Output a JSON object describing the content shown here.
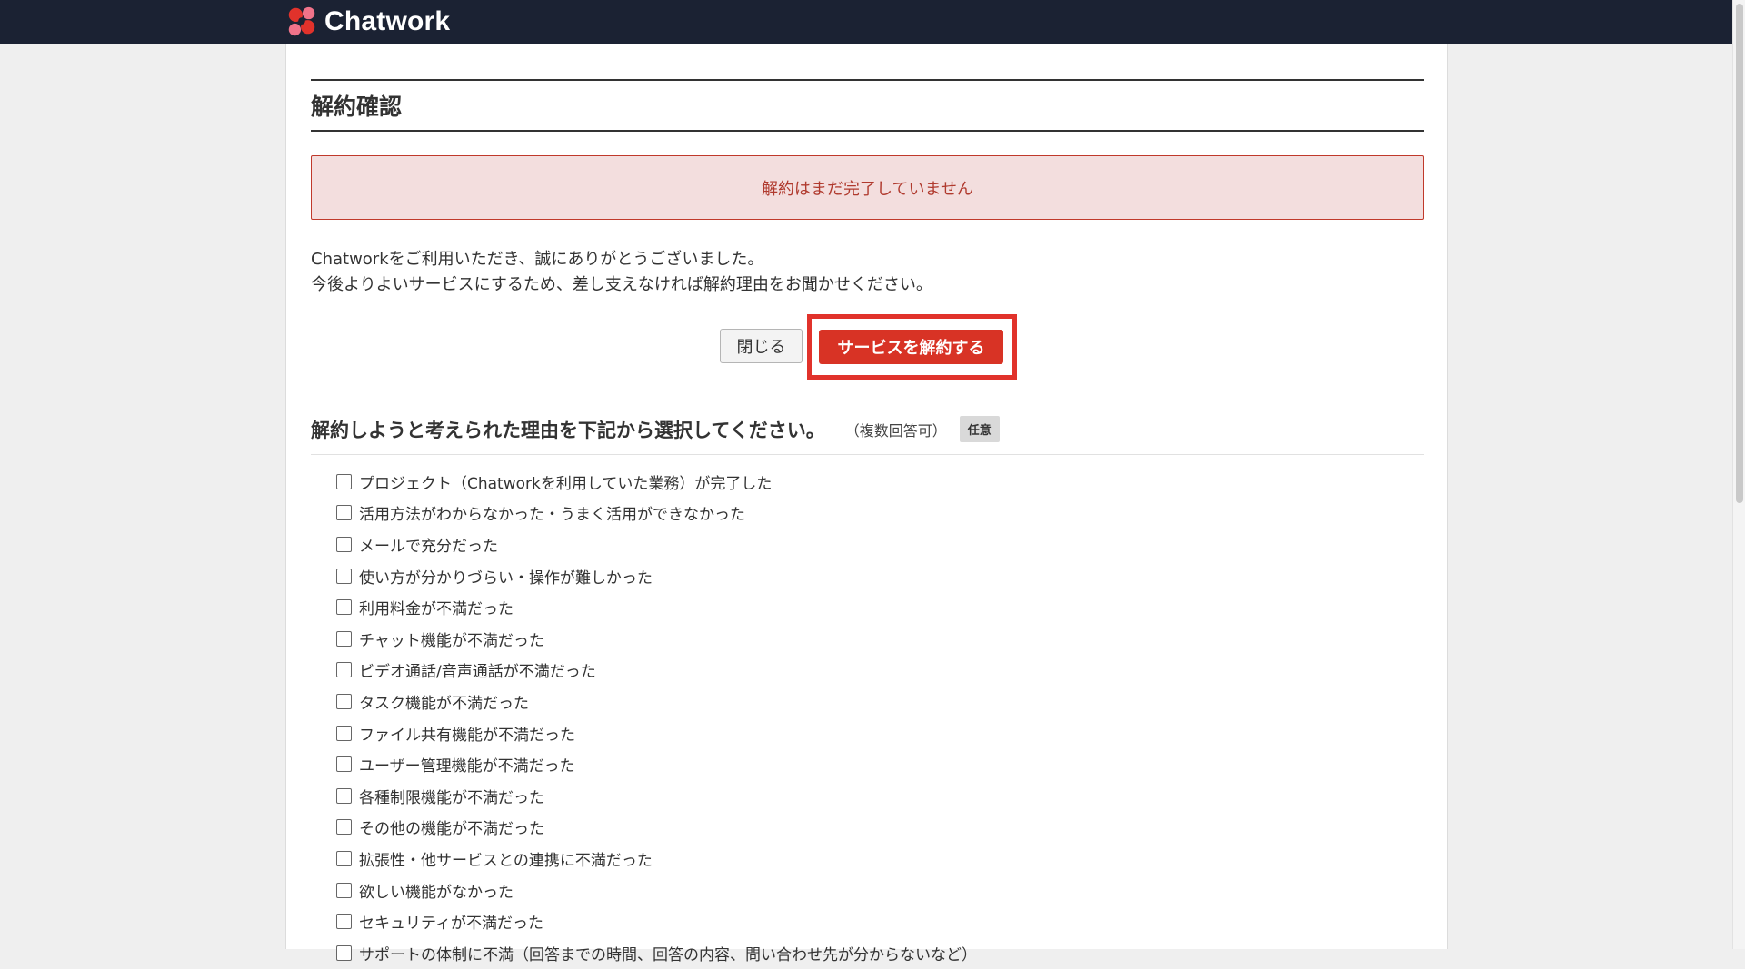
{
  "header": {
    "logo_text": "Chatwork",
    "colors": {
      "background": "#1b2233",
      "logo_red": "#e1322b",
      "logo_pink": "#f0738a"
    }
  },
  "page": {
    "title": "解約確認",
    "alert": "解約はまだ完了していません",
    "description_line1": "Chatworkをご利用いただき、誠にありがとうございました。",
    "description_line2": "今後よりよいサービスにするため、差し支えなければ解約理由をお聞かせください。"
  },
  "buttons": {
    "close_label": "閉じる",
    "cancel_service_label": "サービスを解約する",
    "primary_color": "#d83325",
    "highlight_color": "#e1322b"
  },
  "survey": {
    "title": "解約しようと考えられた理由を下記から選択してください。",
    "note": "（複数回答可）",
    "badge": "任意",
    "reasons": [
      "プロジェクト（Chatworkを利用していた業務）が完了した",
      "活用方法がわからなかった・うまく活用ができなかった",
      "メールで充分だった",
      "使い方が分かりづらい・操作が難しかった",
      "利用料金が不満だった",
      "チャット機能が不満だった",
      "ビデオ通話/音声通話が不満だった",
      "タスク機能が不満だった",
      "ファイル共有機能が不満だった",
      "ユーザー管理機能が不満だった",
      "各種制限機能が不満だった",
      "その他の機能が不満だった",
      "拡張性・他サービスとの連携に不満だった",
      "欲しい機能がなかった",
      "セキュリティが不満だった",
      "サポートの体制に不満（回答までの時間、回答の内容、問い合わせ先が分からないなど）"
    ]
  }
}
